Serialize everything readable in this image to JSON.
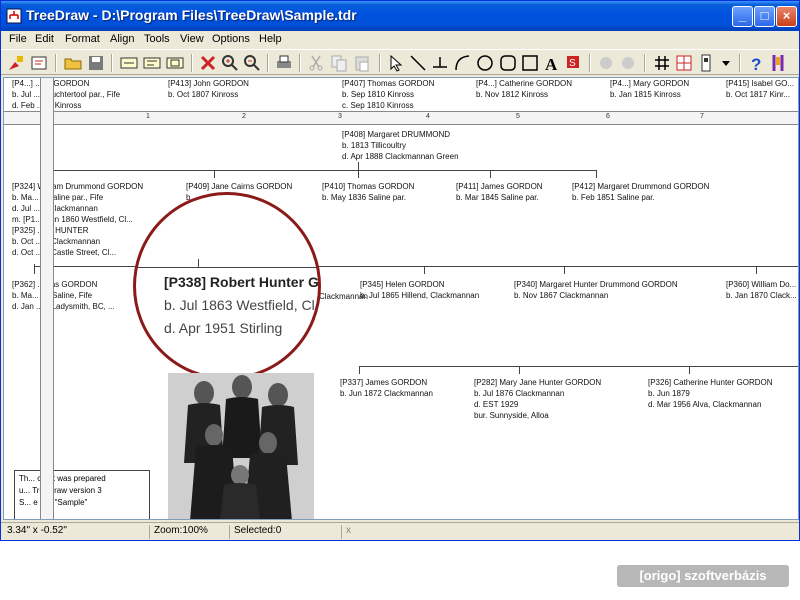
{
  "window": {
    "title": "TreeDraw - D:\\Program Files\\TreeDraw\\Sample.tdr",
    "controls": {
      "minimize": "_",
      "maximize": "□",
      "close": "×"
    }
  },
  "menu": [
    "File",
    "Edit",
    "Format",
    "Align",
    "Tools",
    "View",
    "Options",
    "Help"
  ],
  "toolbar_icons": [
    "new-icon",
    "open-tree-icon",
    "open-folder-icon",
    "save-icon",
    "box-style-1-icon",
    "box-style-2-icon",
    "box-style-3-icon",
    "delete-icon",
    "zoom-in-icon",
    "zoom-out-icon",
    "print-icon",
    "cut-icon",
    "copy-icon",
    "paste-icon",
    "pointer-icon",
    "line-icon",
    "tee-connector-icon",
    "arc-icon",
    "circle-icon",
    "rounded-rect-icon",
    "rect-icon",
    "text-icon",
    "color-icon",
    "grid-icon",
    "snap-icon",
    "page-setup-icon",
    "dropdown-icon",
    "help-icon",
    "context-help-icon"
  ],
  "ruler": {
    "numbers": [
      "1",
      "2",
      "3",
      "4",
      "5",
      "6",
      "7"
    ]
  },
  "tree": {
    "row0": [
      {
        "id": "[P4...]",
        "name": "...ert GORDON",
        "line2": "b. Jul ...6 Auchtertool par., Fife",
        "line3": "d. Feb ...38 Kinross"
      },
      {
        "id": "[P413]",
        "name": "John GORDON",
        "line2": "b. Oct 1807 Kinross",
        "line3": ""
      },
      {
        "id": "[P407]",
        "name": "Thomas GORDON",
        "line2": "b. Sep 1810 Kinross",
        "line3": "c. Sep 1810 Kinross"
      },
      {
        "id": "[P4...]",
        "name": "Catherine GORDON",
        "line2": "b. Nov 1812 Kinross",
        "line3": ""
      },
      {
        "id": "[P4...]",
        "name": "Mary GORDON",
        "line2": "b. Jan 1815 Kinross",
        "line3": ""
      },
      {
        "id": "[P415]",
        "name": "Isabel GO...",
        "line2": "b. Oct 1817 Kinr...",
        "line3": ""
      }
    ],
    "spouse": {
      "id": "[P408]",
      "name": "Margaret DRUMMOND",
      "line2": "b. 1813 Tillicoultry",
      "line3": "d. Apr 1888 Clackmannan Green"
    },
    "row1": [
      {
        "id": "[P324]",
        "name": "William Drummond GORDON",
        "line2": "b. Ma... 8 Saline par., Fife",
        "line3": "d. Jul ... 9 Clackmannan",
        "line4": "m. [P1...] Jun 1860 Westfield, Cl...",
        "line5": "[P325] ...ne HUNTER",
        "line6": "b. Oct ... 8 Clackmannan",
        "line7": "d. Oct ... 8 Castle Street, Cl..."
      },
      {
        "id": "[P409]",
        "name": "Jane Cairns GORDON",
        "line2": "b. ... ...par.",
        "line3": ""
      },
      {
        "id": "[P410]",
        "name": "Thomas GORDON",
        "line2": "b. May 1836 Saline par.",
        "line3": ""
      },
      {
        "id": "[P411]",
        "name": "James GORDON",
        "line2": "b. Mar 1845 Saline par.",
        "line3": ""
      },
      {
        "id": "[P412]",
        "name": "Margaret Drummond GORDON",
        "line2": "b. Feb 1851 Saline par.",
        "line3": ""
      }
    ],
    "row2": [
      {
        "id": "[P362]",
        "name": "...mas GORDON",
        "line2": "b. Ma... 61 Saline, Fife",
        "line3": "d. Jan ... 9 Ladysmith, BC, ..."
      },
      {
        "id": "[P345]",
        "name": "Helen GORDON",
        "line2": "b. Jul 1865 Hillend, Clackmannan",
        "line3": ""
      },
      {
        "id": "[P340]",
        "name": "Margaret Hunter Drummond GORDON",
        "line2": "b. Nov 1867 Clackmannan",
        "line3": ""
      },
      {
        "id": "[P360]",
        "name": "William Do...",
        "line2": "b. Jan 1870 Clack...",
        "line3": ""
      }
    ],
    "row2_partial": "Clackmannan",
    "row3": [
      {
        "id": "[P337]",
        "name": "James GORDON",
        "line2": "b. Jun 1872 Clackmannan",
        "line3": "",
        "line4": ""
      },
      {
        "id": "[P282]",
        "name": "Mary Jane Hunter GORDON",
        "line2": "b. Jul 1876 Clackmannan",
        "line3": "d. EST 1929",
        "line4": "bur.  Sunnyside, Alloa"
      },
      {
        "id": "[P326]",
        "name": "Catherine Hunter GORDON",
        "line2": "b. Jun 1879",
        "line3": "d. Mar 1956 Alva, Clackmannan",
        "line4": ""
      }
    ]
  },
  "magnifier": {
    "id": "[P338]",
    "name": "Robert Hunter",
    "born": "b. Jul 1863 Westfield, Cl...",
    "died": "d. Apr 1951 Stirling",
    "edge": "Go"
  },
  "note": {
    "line1": "Th... chart was prepared",
    "line2": "u... TreeDraw version 3",
    "line3": "S... e file: \"Sample\""
  },
  "status": {
    "coords": "3.34\" x -0.52\"",
    "zoom": "Zoom:100%",
    "selected": "Selected:0",
    "x": "x"
  },
  "watermark": "[origo] szoftverbázis",
  "colors": {
    "titlebar": "#0053e0",
    "magnifier_border": "#8b1a1a",
    "watermark_bg": "#b7b7b7"
  }
}
